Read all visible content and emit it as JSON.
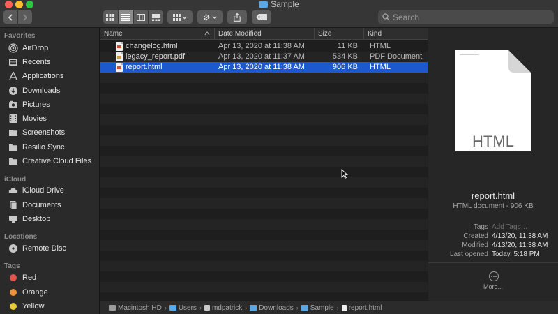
{
  "window": {
    "title": "Sample"
  },
  "toolbar": {
    "search_placeholder": "Search"
  },
  "sidebar": {
    "favorites_label": "Favorites",
    "favorites": [
      {
        "label": "AirDrop",
        "icon": "airdrop-icon"
      },
      {
        "label": "Recents",
        "icon": "recents-icon"
      },
      {
        "label": "Applications",
        "icon": "applications-icon"
      },
      {
        "label": "Downloads",
        "icon": "downloads-icon"
      },
      {
        "label": "Pictures",
        "icon": "pictures-icon"
      },
      {
        "label": "Movies",
        "icon": "movies-icon"
      },
      {
        "label": "Screenshots",
        "icon": "folder-icon"
      },
      {
        "label": "Resilio Sync",
        "icon": "folder-icon"
      },
      {
        "label": "Creative Cloud Files",
        "icon": "folder-icon"
      }
    ],
    "icloud_label": "iCloud",
    "icloud": [
      {
        "label": "iCloud Drive",
        "icon": "cloud-icon"
      },
      {
        "label": "Documents",
        "icon": "documents-icon"
      },
      {
        "label": "Desktop",
        "icon": "desktop-icon"
      }
    ],
    "locations_label": "Locations",
    "locations": [
      {
        "label": "Remote Disc",
        "icon": "disc-icon"
      }
    ],
    "tags_label": "Tags",
    "tags": [
      {
        "label": "Red",
        "color": "#e5534b"
      },
      {
        "label": "Orange",
        "color": "#f0913b"
      },
      {
        "label": "Yellow",
        "color": "#e8c93a"
      }
    ]
  },
  "list": {
    "columns": {
      "name": "Name",
      "date": "Date Modified",
      "size": "Size",
      "kind": "Kind"
    },
    "rows": [
      {
        "name": "changelog.html",
        "date": "Apr 13, 2020 at 11:38 AM",
        "size": "11 KB",
        "kind": "HTML"
      },
      {
        "name": "legacy_report.pdf",
        "date": "Apr 13, 2020 at 11:37 AM",
        "size": "534 KB",
        "kind": "PDF Document"
      },
      {
        "name": "report.html",
        "date": "Apr 13, 2020 at 11:38 AM",
        "size": "906 KB",
        "kind": "HTML"
      }
    ],
    "selected_index": 2
  },
  "preview": {
    "doc_label": "HTML",
    "name": "report.html",
    "subtitle": "HTML document - 906 KB",
    "meta": {
      "tags_key": "Tags",
      "tags_val": "Add Tags…",
      "created_key": "Created",
      "created_val": "4/13/20, 11:38 AM",
      "modified_key": "Modified",
      "modified_val": "4/13/20, 11:38 AM",
      "opened_key": "Last opened",
      "opened_val": "Today, 5:18 PM"
    },
    "more_label": "More..."
  },
  "pathbar": {
    "crumbs": [
      "Macintosh HD",
      "Users",
      "mdpatrick",
      "Downloads",
      "Sample",
      "report.html"
    ]
  }
}
